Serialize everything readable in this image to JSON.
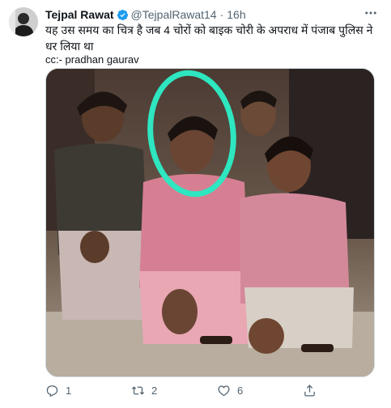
{
  "tweet": {
    "author_name": "Tejpal Rawat",
    "handle": "@TejpalRawat14",
    "separator": "·",
    "time": "16h",
    "text": "यह उस समय का चित्र है जब 4 चोरों को बाइक चोरी के अपराध में पंजाब पुलिस ने धर लिया था",
    "cc_line": "cc:- pradhan gaurav"
  },
  "actions": {
    "reply_count": "1",
    "retweet_count": "2",
    "like_count": "6"
  },
  "icons": {
    "verified": "verified-badge-icon",
    "more": "more-options-icon",
    "reply": "reply-icon",
    "retweet": "retweet-icon",
    "like": "like-icon",
    "share": "share-icon"
  },
  "colors": {
    "verified": "#1d9bf0",
    "secondary_text": "#536471",
    "highlight_circle": "#2ee6c0"
  }
}
